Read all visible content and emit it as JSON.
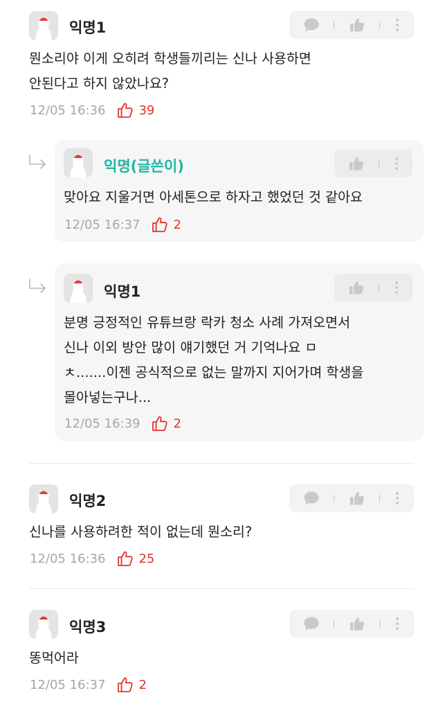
{
  "comments": [
    {
      "nickname": "익명1",
      "lines": [
        "뭔소리야 이게 오히려 학생들끼리는 신나 사용하면",
        "안된다고 하지 않았나요?"
      ],
      "time": "12/05 16:36",
      "likes": "39"
    },
    {
      "nickname": "익명(글쓴이)",
      "lines": [
        "맞아요 지울거면 아세톤으로 하자고 했었던 것 같아요"
      ],
      "time": "12/05 16:37",
      "likes": "2"
    },
    {
      "nickname": "익명1",
      "lines": [
        "분명 긍정적인 유튜브랑 락카 청소 사례 가져오면서",
        "신나 이외 방안 많이 얘기했던 거 기억나요 ㅁ",
        "ㅊ.......이젠 공식적으로 없는 말까지 지어가며 학생을",
        "몰아넣는구나..."
      ],
      "time": "12/05 16:39",
      "likes": "2"
    },
    {
      "nickname": "익명2",
      "lines": [
        "신나를 사용하려한 적이 없는데 뭔소리?"
      ],
      "time": "12/05 16:36",
      "likes": "25"
    },
    {
      "nickname": "익명3",
      "lines": [
        "똥먹어라"
      ],
      "time": "12/05 16:37",
      "likes": "2"
    }
  ],
  "colors": {
    "writer_nickname": "#1eb7a4",
    "like_count": "#e2332b",
    "timestamp": "#a6a6a6",
    "reply_background": "#f6f6f6"
  },
  "icons": {
    "reply": "speech-bubble-icon",
    "vote": "thumbs-up-icon",
    "more": "more-vertical-icon",
    "like": "thumbs-up-outline-icon",
    "nested": "reply-arrow-icon"
  }
}
